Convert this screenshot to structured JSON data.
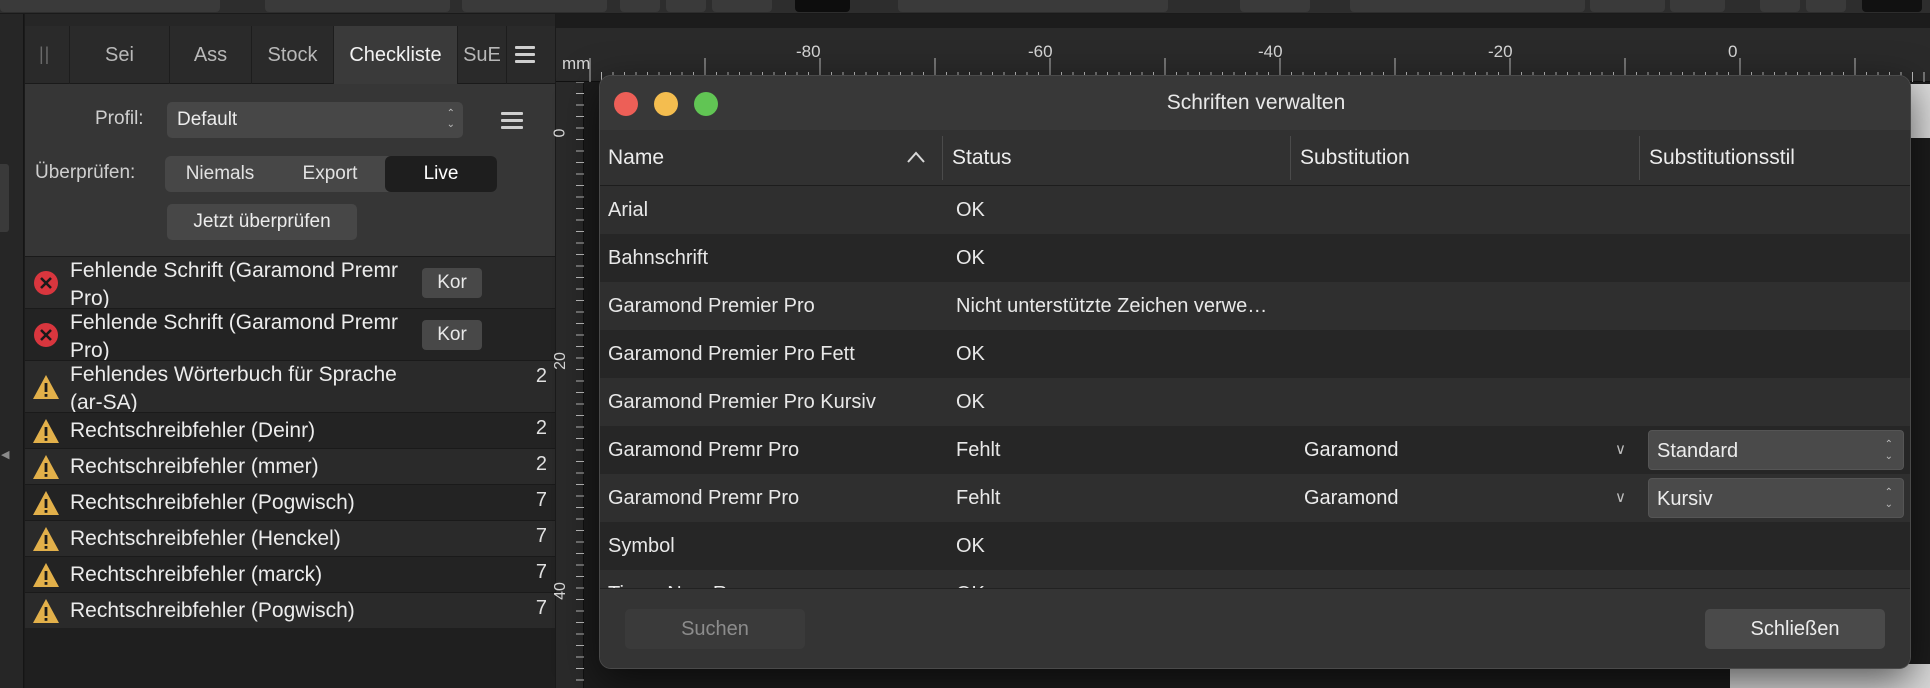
{
  "studio": {
    "tabs": [
      "Sei",
      "Ass",
      "Stock",
      "Checkliste",
      "SuE"
    ],
    "active_tab": "Checkliste",
    "profile_label": "Profil:",
    "profile_value": "Default",
    "check_label": "Überprüfen:",
    "check_modes": [
      "Niemals",
      "Export",
      "Live"
    ],
    "check_mode_selected": "Live",
    "check_now_button": "Jetzt überprüfen",
    "issues": [
      {
        "type": "error",
        "text": "Fehlende Schrift (Garamond Premr Pro)",
        "action": "Kor",
        "count": ""
      },
      {
        "type": "error",
        "text": "Fehlende Schrift (Garamond Premr Pro)",
        "action": "Kor",
        "count": ""
      },
      {
        "type": "warning",
        "text": "Fehlendes Wörterbuch für Sprache (ar-SA)",
        "action": "",
        "count": "2"
      },
      {
        "type": "warning",
        "text": "Rechtschreibfehler (Deinr)",
        "action": "",
        "count": "2"
      },
      {
        "type": "warning",
        "text": "Rechtschreibfehler (mmer)",
        "action": "",
        "count": "2"
      },
      {
        "type": "warning",
        "text": "Rechtschreibfehler (Pogwisch)",
        "action": "",
        "count": "7"
      },
      {
        "type": "warning",
        "text": "Rechtschreibfehler (Henckel)",
        "action": "",
        "count": "7"
      },
      {
        "type": "warning",
        "text": "Rechtschreibfehler (marck)",
        "action": "",
        "count": "7"
      },
      {
        "type": "warning",
        "text": "Rechtschreibfehler (Pogwisch)",
        "action": "",
        "count": "7"
      }
    ]
  },
  "ruler": {
    "unit": "mm",
    "top_labels": [
      "-80",
      "-60",
      "-40",
      "-20",
      "0"
    ],
    "left_labels": [
      "0",
      "20",
      "40"
    ]
  },
  "dialog": {
    "title": "Schriften verwalten",
    "columns": [
      "Name",
      "Status",
      "Substitution",
      "Substitutionsstil"
    ],
    "rows": [
      {
        "name": "Arial",
        "status": "OK",
        "substitution": "",
        "style": ""
      },
      {
        "name": "Bahnschrift",
        "status": "OK",
        "substitution": "",
        "style": ""
      },
      {
        "name": "Garamond Premier Pro",
        "status": "Nicht unterstützte Zeichen verwe…",
        "substitution": "",
        "style": ""
      },
      {
        "name": "Garamond Premier Pro Fett",
        "status": "OK",
        "substitution": "",
        "style": ""
      },
      {
        "name": "Garamond Premier Pro Kursiv",
        "status": "OK",
        "substitution": "",
        "style": ""
      },
      {
        "name": "Garamond Premr Pro",
        "status": "Fehlt",
        "substitution": "Garamond",
        "style": "Standard"
      },
      {
        "name": "Garamond Premr Pro",
        "status": "Fehlt",
        "substitution": "Garamond",
        "style": "Kursiv"
      },
      {
        "name": "Symbol",
        "status": "OK",
        "substitution": "",
        "style": ""
      },
      {
        "name": "Times New Roman",
        "status": "OK",
        "substitution": "",
        "style": ""
      }
    ],
    "search_button": "Suchen",
    "close_button": "Schließen"
  },
  "colors": {
    "error": "#d9363e",
    "warning": "#e2b04a",
    "traffic_red": "#ed5f57",
    "traffic_yellow": "#f4bd4f",
    "traffic_green": "#61c554"
  }
}
